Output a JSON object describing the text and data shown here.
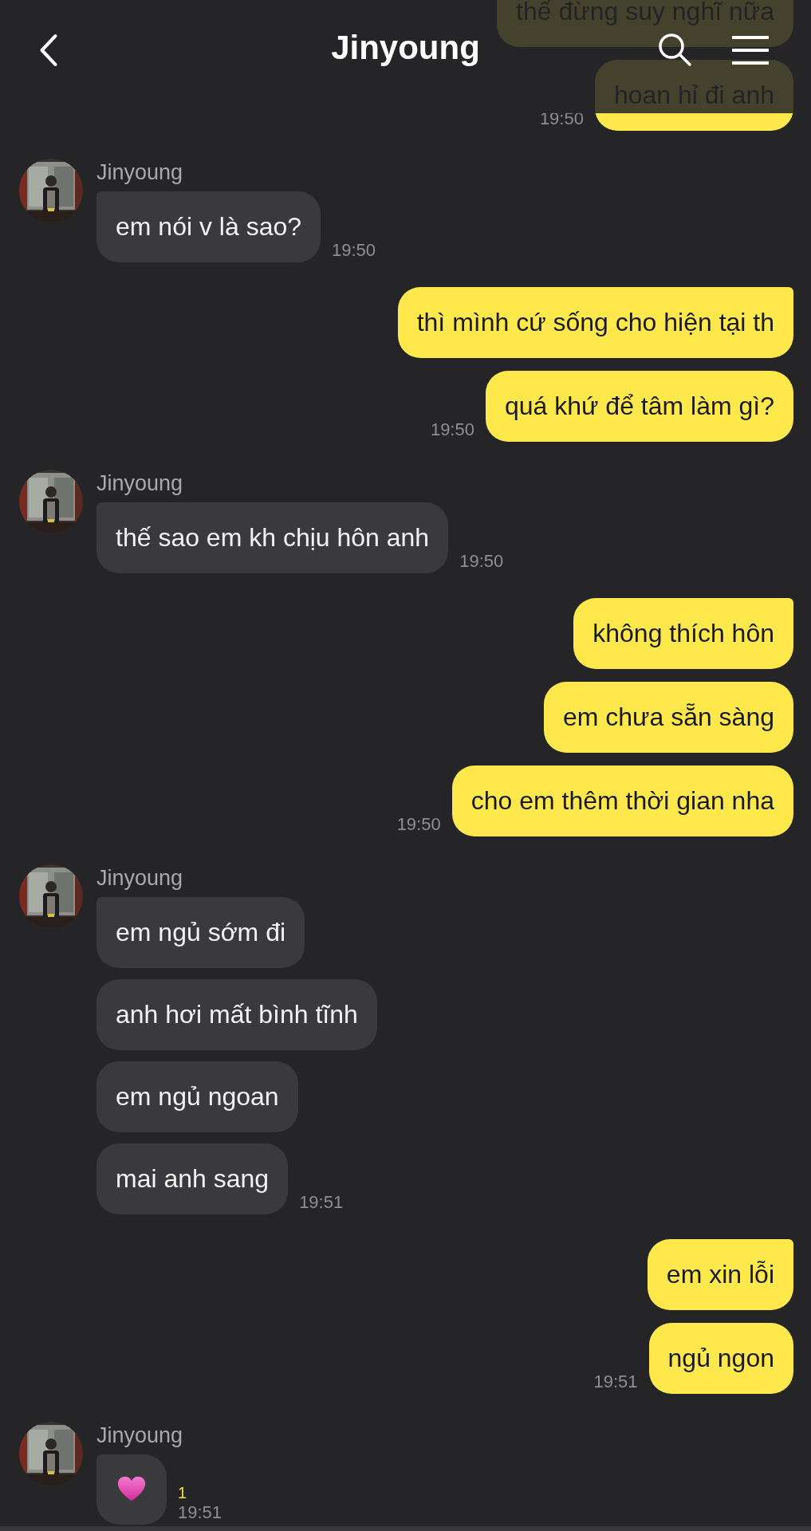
{
  "header": {
    "title": "Jinyoung"
  },
  "groups": [
    {
      "kind": "sent",
      "messages": [
        {
          "kind": "text",
          "text": "thế đừng suy nghĩ nữa"
        },
        {
          "kind": "text",
          "text": "hoan hỉ đi anh"
        }
      ],
      "time": "19:50"
    },
    {
      "kind": "received",
      "name": "Jinyoung",
      "messages": [
        {
          "kind": "text",
          "text": "em nói v là sao?"
        }
      ],
      "time": "19:50"
    },
    {
      "kind": "sent",
      "messages": [
        {
          "kind": "text",
          "text": "thì mình cứ sống cho hiện tại th"
        },
        {
          "kind": "text",
          "text": "quá khứ để tâm làm gì?"
        }
      ],
      "time": "19:50"
    },
    {
      "kind": "received",
      "name": "Jinyoung",
      "messages": [
        {
          "kind": "text",
          "text": "thế sao em kh chịu hôn anh"
        }
      ],
      "time": "19:50"
    },
    {
      "kind": "sent",
      "messages": [
        {
          "kind": "text",
          "text": "không thích hôn"
        },
        {
          "kind": "text",
          "text": "em chưa sẵn sàng"
        },
        {
          "kind": "text",
          "text": "cho em thêm thời gian nha"
        }
      ],
      "time": "19:50"
    },
    {
      "kind": "received",
      "name": "Jinyoung",
      "messages": [
        {
          "kind": "text",
          "text": "em ngủ sớm đi"
        },
        {
          "kind": "text",
          "text": "anh hơi mất bình tĩnh"
        },
        {
          "kind": "text",
          "text": "em ngủ ngoan"
        },
        {
          "kind": "text",
          "text": "mai anh sang"
        }
      ],
      "time": "19:51"
    },
    {
      "kind": "sent",
      "messages": [
        {
          "kind": "text",
          "text": "em xin lỗi"
        },
        {
          "kind": "text",
          "text": "ngủ ngon"
        }
      ],
      "time": "19:51"
    },
    {
      "kind": "received",
      "name": "Jinyoung",
      "messages": [
        {
          "kind": "heart"
        }
      ],
      "unread": "1",
      "time": "19:51"
    }
  ]
}
